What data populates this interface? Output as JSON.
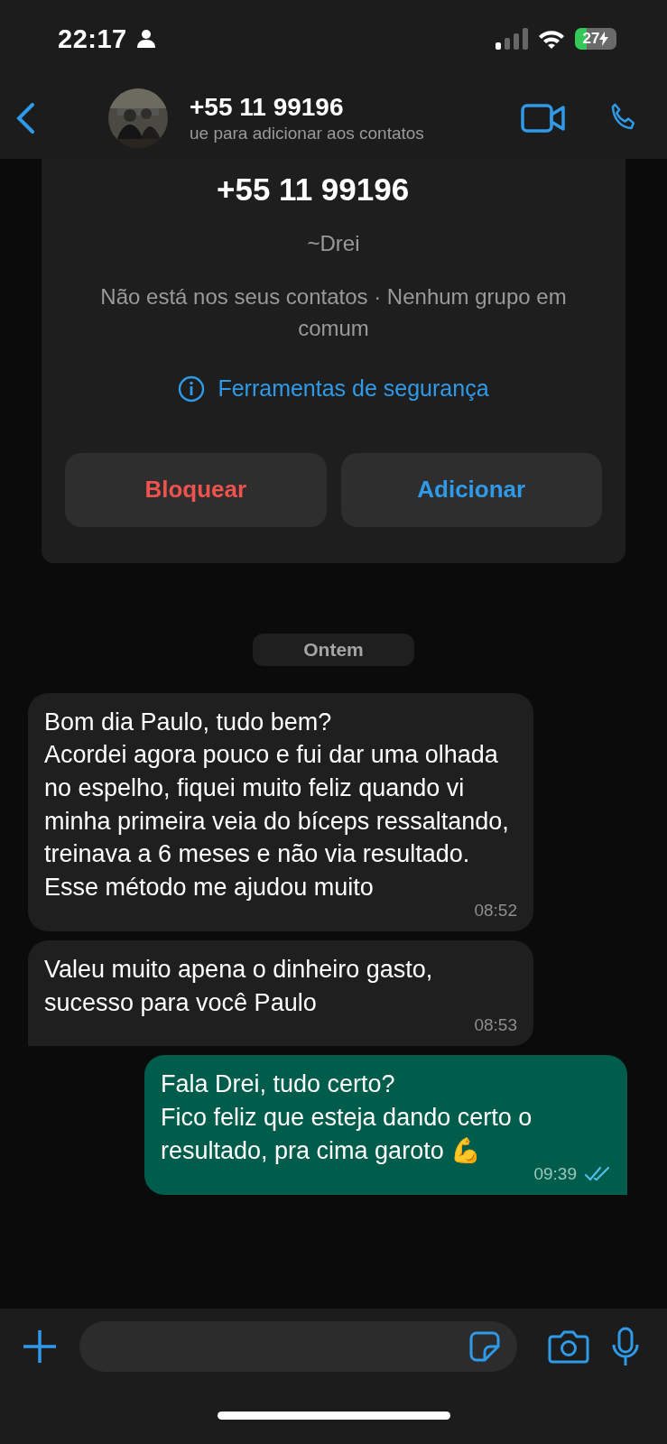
{
  "status_bar": {
    "time": "22:17",
    "battery": "27"
  },
  "header": {
    "title": "+55 11 99196",
    "subtitle": "ue para adicionar aos contatos"
  },
  "contact_card": {
    "phone": "+55 11 99196",
    "name": "~Drei",
    "info": "Não está nos seus contatos · Nenhum grupo em comum",
    "safety_link": "Ferramentas de segurança",
    "buttons": [
      {
        "label": "Bloquear",
        "kind": "danger"
      },
      {
        "label": "Adicionar",
        "kind": "primary"
      }
    ]
  },
  "date_chip": "Ontem",
  "messages": [
    {
      "kind": "in",
      "text": "Bom dia Paulo, tudo bem?\nAcordei agora pouco e fui dar uma olhada no espelho, fiquei muito feliz quando vi minha primeira veia do bíceps ressaltando, treinava a 6 meses e não via resultado. Esse método me ajudou muito",
      "time": "08:52",
      "tail": false
    },
    {
      "kind": "in",
      "text": "Valeu muito apena o dinheiro gasto, sucesso para você Paulo",
      "time": "08:53",
      "tail": true
    },
    {
      "kind": "out",
      "text": "Fala Drei, tudo certo?\nFico feliz que esteja dando certo o resultado, pra cima garoto 💪",
      "time": "09:39",
      "tail": true,
      "read": true
    }
  ]
}
